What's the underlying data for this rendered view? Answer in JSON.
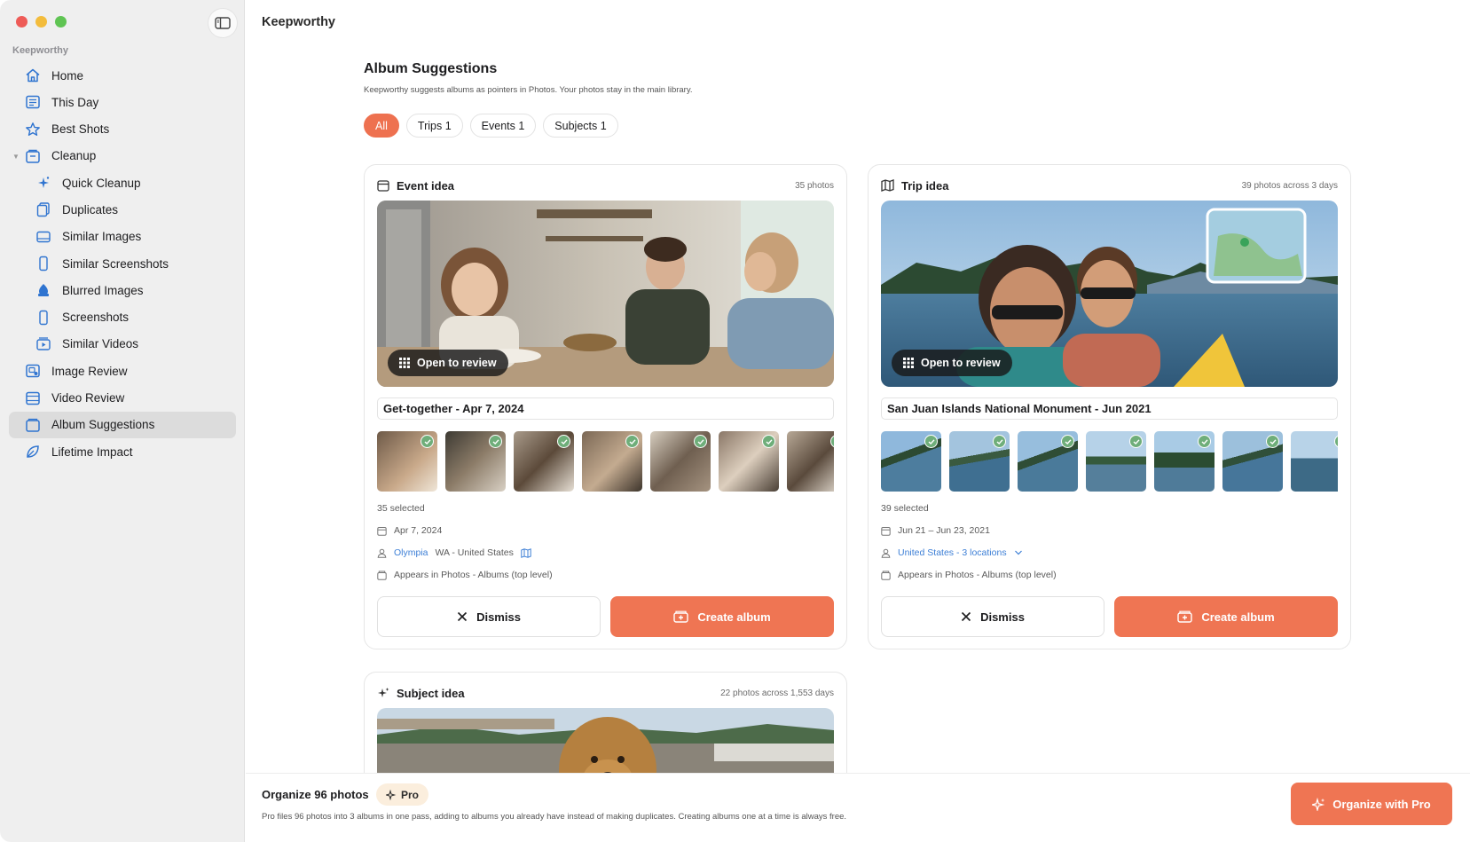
{
  "app": {
    "name": "Keepworthy"
  },
  "sidebar": {
    "section": "Keepworthy",
    "items": [
      {
        "label": "Home",
        "icon": "house-icon",
        "sub": false
      },
      {
        "label": "This Day",
        "icon": "calendar-list-icon",
        "sub": false
      },
      {
        "label": "Best Shots",
        "icon": "star-icon",
        "sub": false
      },
      {
        "label": "Cleanup",
        "icon": "tray-icon",
        "sub": false
      },
      {
        "label": "Quick Cleanup",
        "icon": "sparkles-icon",
        "sub": true
      },
      {
        "label": "Duplicates",
        "icon": "duplicate-icon",
        "sub": true
      },
      {
        "label": "Similar Images",
        "icon": "image-stack-icon",
        "sub": true
      },
      {
        "label": "Similar Screenshots",
        "icon": "phone-icon",
        "sub": true
      },
      {
        "label": "Blurred Images",
        "icon": "blur-icon",
        "sub": true
      },
      {
        "label": "Screenshots",
        "icon": "phone-icon",
        "sub": true
      },
      {
        "label": "Similar Videos",
        "icon": "video-stack-icon",
        "sub": true
      },
      {
        "label": "Image Review",
        "icon": "image-review-icon",
        "sub": false
      },
      {
        "label": "Video Review",
        "icon": "film-icon",
        "sub": false
      },
      {
        "label": "Album Suggestions",
        "icon": "album-icon",
        "sub": false,
        "active": true
      },
      {
        "label": "Lifetime Impact",
        "icon": "leaf-icon",
        "sub": false
      }
    ]
  },
  "page": {
    "title": "Album Suggestions",
    "subtitle": "Keepworthy suggests albums as pointers in Photos. Your photos stay in the main library.",
    "filters": [
      "All",
      "Trips 1",
      "Events 1",
      "Subjects 1"
    ]
  },
  "cards": {
    "event": {
      "type": "Event idea",
      "count": "35 photos",
      "open_label": "Open to review",
      "name": "Get-together - Apr 7, 2024",
      "selected": "35 selected",
      "date": "Apr 7, 2024",
      "location_link": "Olympia",
      "location_rest": "WA - United States",
      "appears": "Appears in Photos - Albums (top level)",
      "dismiss": "Dismiss",
      "create": "Create album"
    },
    "trip": {
      "type": "Trip idea",
      "count": "39 photos across 3 days",
      "open_label": "Open to review",
      "map_label": "San Juan Islands National Monument",
      "name": "San Juan Islands National Monument - Jun 2021",
      "selected": "39 selected",
      "date": "Jun 21 – Jun 23, 2021",
      "location_link": "United States - 3 locations",
      "appears": "Appears in Photos - Albums (top level)",
      "dismiss": "Dismiss",
      "create": "Create album"
    },
    "subject": {
      "type": "Subject idea",
      "count": "22 photos across 1,553 days"
    }
  },
  "footer": {
    "title": "Organize 96 photos",
    "badge": "Pro",
    "description": "Pro files 96 photos into 3 albums in one pass, adding to albums you already have instead of making duplicates. Creating albums one at a time is always free.",
    "button": "Organize with Pro"
  },
  "colors": {
    "accent": "#ef7553",
    "link": "#3d7fd6",
    "sidebar_icon": "#2f74d0"
  }
}
